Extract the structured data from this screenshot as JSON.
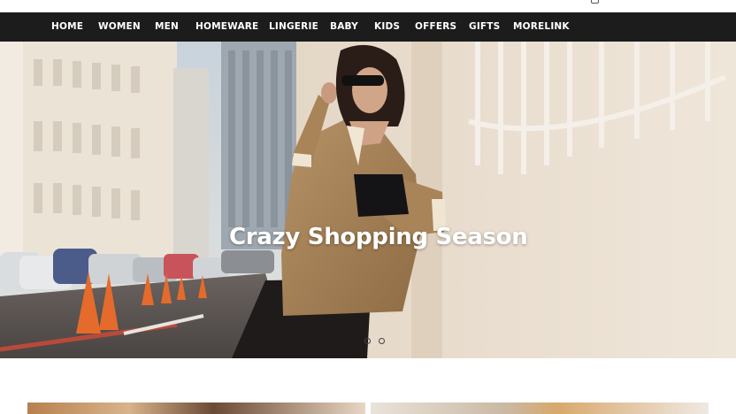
{
  "nav": {
    "items": [
      {
        "label": "HOME"
      },
      {
        "label": "WOMEN"
      },
      {
        "label": "MEN"
      },
      {
        "label": "HOMEWARE"
      },
      {
        "label": "LINGERIE"
      },
      {
        "label": "BABY"
      },
      {
        "label": "KIDS"
      },
      {
        "label": "OFFERS"
      },
      {
        "label": "GIFTS"
      },
      {
        "label": "MORELINK"
      }
    ]
  },
  "hero": {
    "title": "Crazy Shopping Season",
    "slide_count": 2,
    "active_slide": 1
  },
  "colors": {
    "nav_bg": "#1c1c1c",
    "nav_text": "#ffffff",
    "hero_text": "#ffffff"
  }
}
